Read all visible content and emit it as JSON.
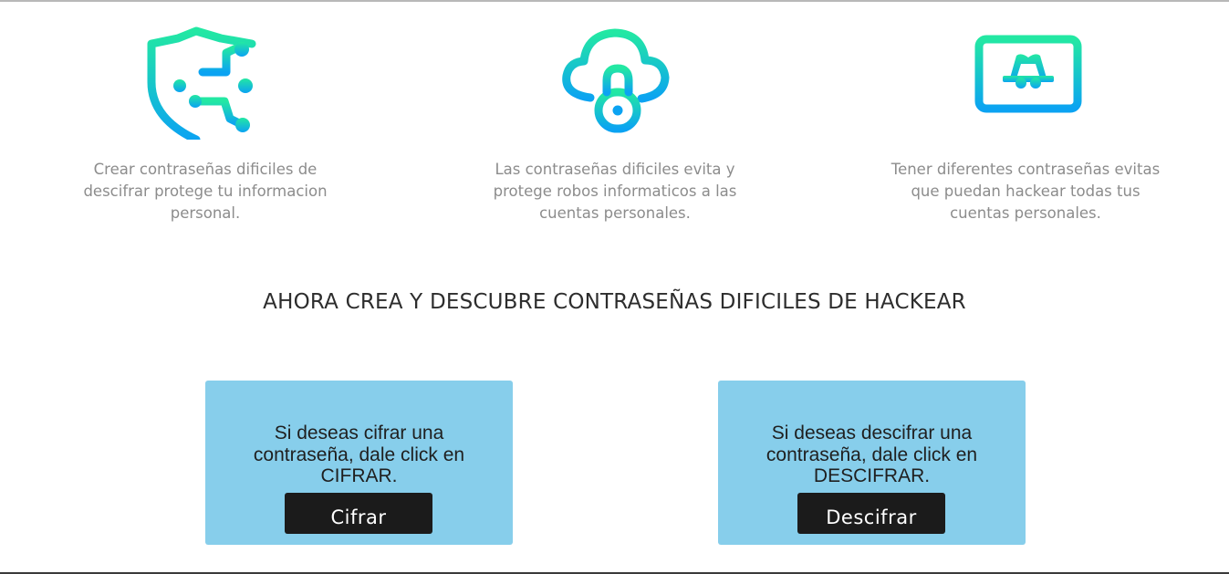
{
  "colors": {
    "gradient_top": "#23e8a3",
    "gradient_bottom": "#0ba3f2",
    "card_bg": "#87ceeb",
    "button_bg": "#1b1b1b"
  },
  "features": [
    {
      "icon": "shield-circuit-icon",
      "text": "Crear contraseñas dificiles de descifrar protege tu informacion personal."
    },
    {
      "icon": "cloud-lock-icon",
      "text": "Las contraseñas dificiles evita y protege robos informaticos a las cuentas personales."
    },
    {
      "icon": "monitor-hacker-icon",
      "text": "Tener diferentes contraseñas evitas que puedan hackear todas tus cuentas personales."
    }
  ],
  "section_title": "AHORA CREA Y DESCUBRE CONTRASEÑAS DIFICILES DE HACKEAR",
  "cards": [
    {
      "message": "Si deseas cifrar una contraseña, dale click en CIFRAR.",
      "button_label": "Cifrar"
    },
    {
      "message": "Si deseas descifrar una contraseña, dale click en DESCIFRAR.",
      "button_label": "Descifrar"
    }
  ]
}
